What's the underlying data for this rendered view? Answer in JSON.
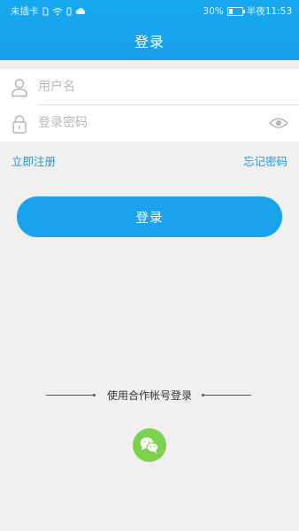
{
  "status_bar": {
    "carrier": "未插卡",
    "battery": "30%",
    "battery_level": 0.3,
    "time": "半夜11:53"
  },
  "header": {
    "title": "登录"
  },
  "form": {
    "username_placeholder": "用户名",
    "password_placeholder": "登录密码"
  },
  "links": {
    "register": "立即注册",
    "forgot": "忘记密码"
  },
  "login_button": "登录",
  "partner_login": {
    "text": "使用合作帐号登录",
    "provider_icon": "wechat-icon"
  },
  "colors": {
    "primary": "#1aa3ec",
    "link": "#1a9be6",
    "wechat": "#7ed04f",
    "background": "#f0f0f0"
  }
}
